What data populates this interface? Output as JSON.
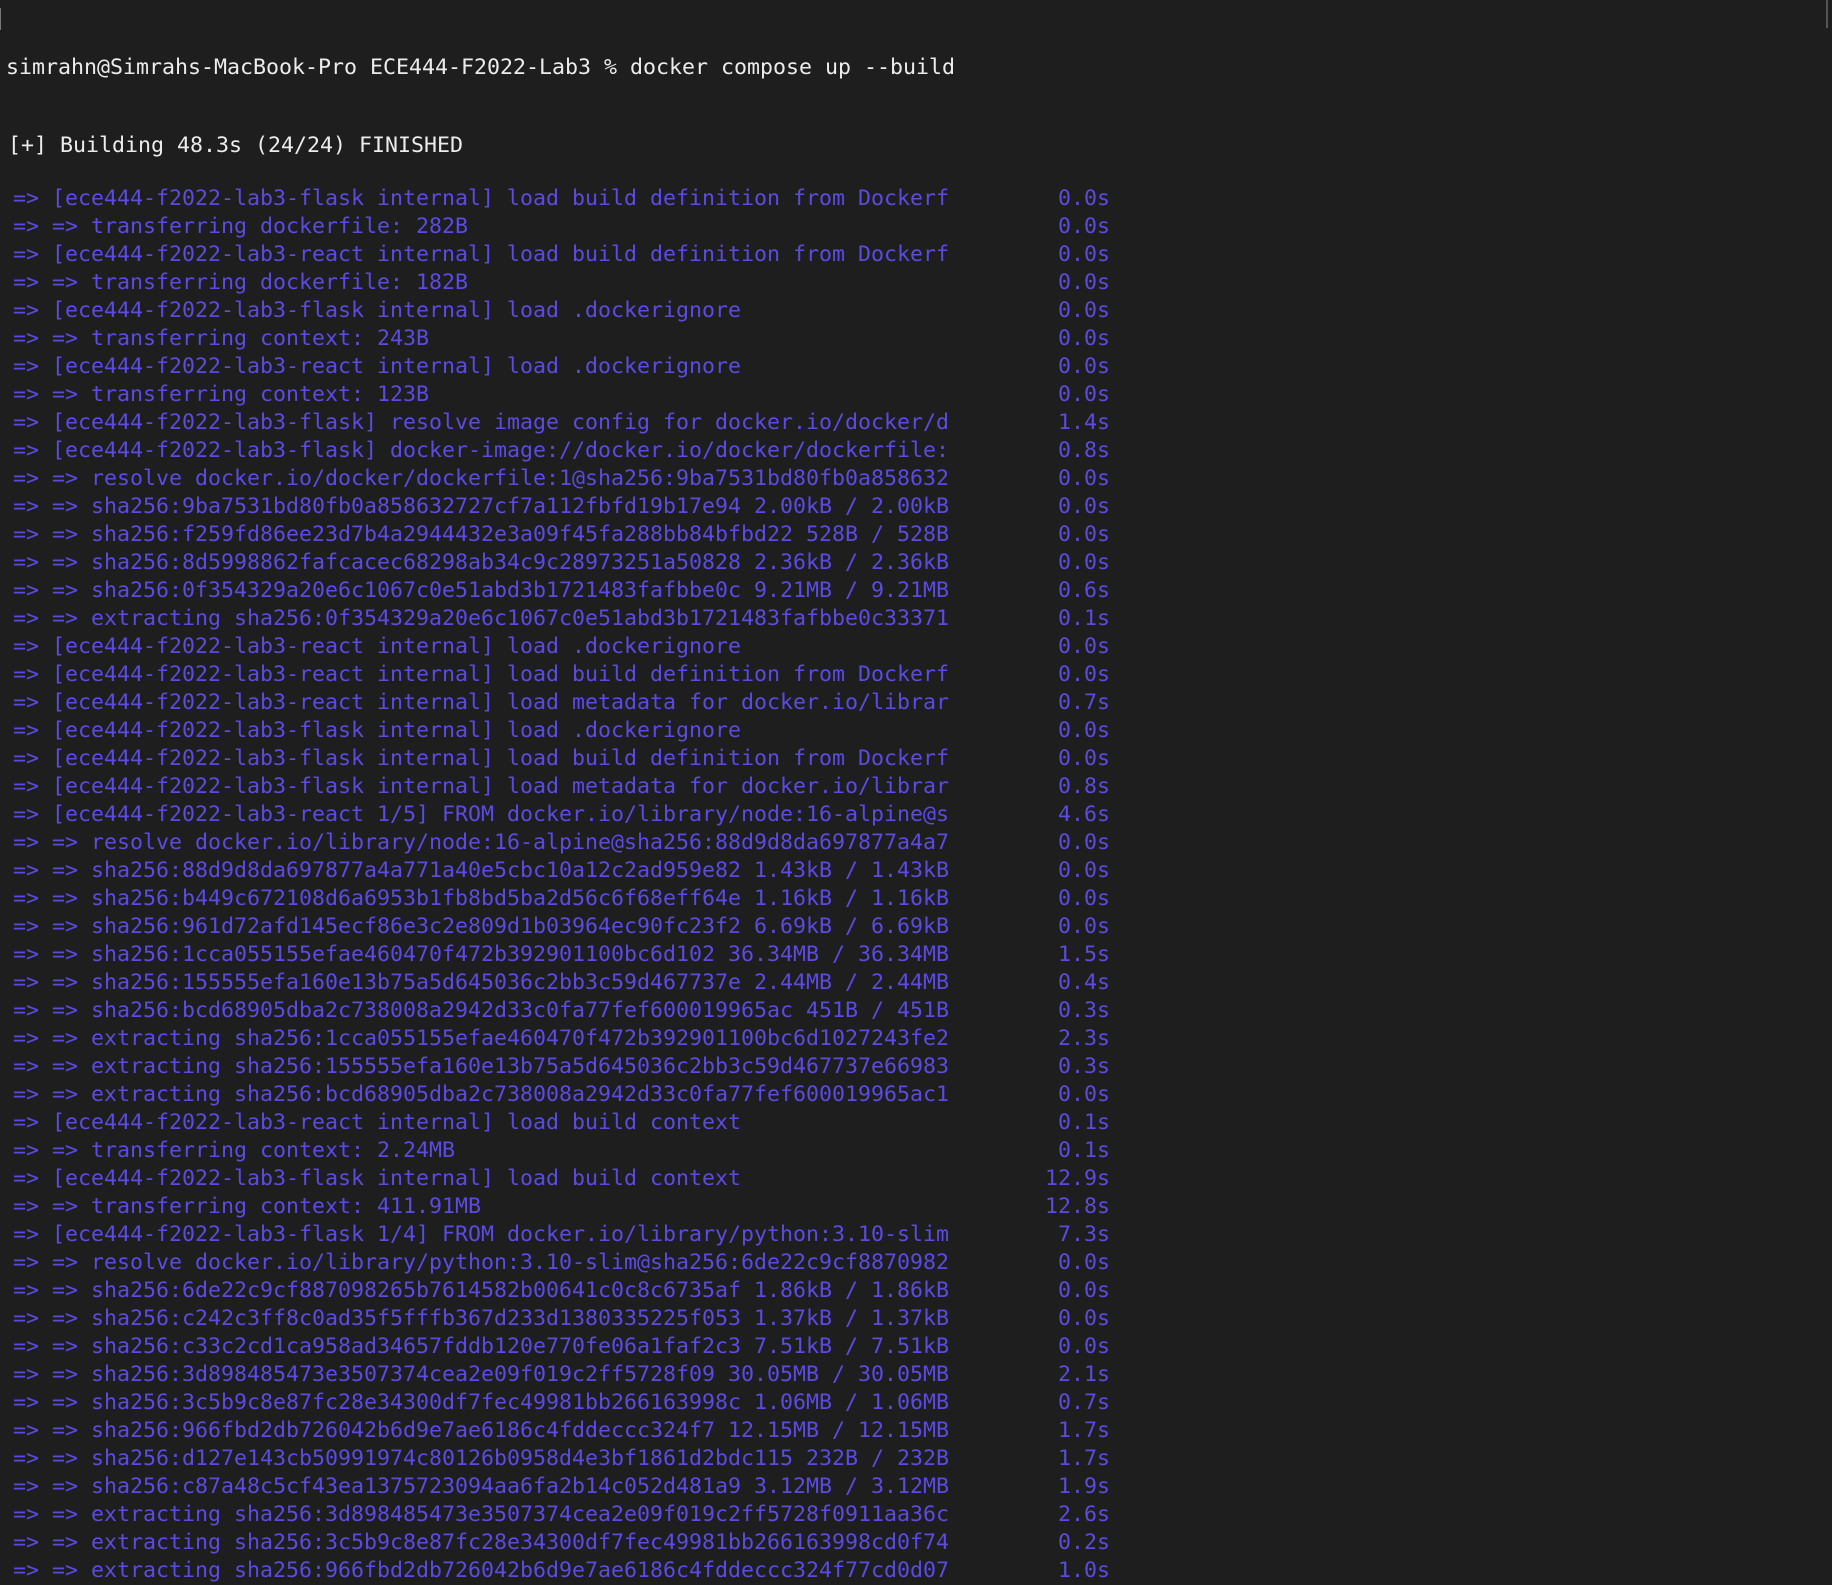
{
  "terminal": {
    "prompt": "simrahn@Simrahs-MacBook-Pro ECE444-F2022-Lab3 % docker compose up --build",
    "status": "[+] Building 48.3s (24/24) FINISHED",
    "text_color": "#ececec",
    "log_color": "#5b4be3",
    "background": "#1e1e1e",
    "lines": [
      {
        "text": " => [ece444-f2022-lab3-flask internal] load build definition from Dockerf",
        "time": "0.0s"
      },
      {
        "text": " => => transferring dockerfile: 282B",
        "time": "0.0s"
      },
      {
        "text": " => [ece444-f2022-lab3-react internal] load build definition from Dockerf",
        "time": "0.0s"
      },
      {
        "text": " => => transferring dockerfile: 182B",
        "time": "0.0s"
      },
      {
        "text": " => [ece444-f2022-lab3-flask internal] load .dockerignore",
        "time": "0.0s"
      },
      {
        "text": " => => transferring context: 243B",
        "time": "0.0s"
      },
      {
        "text": " => [ece444-f2022-lab3-react internal] load .dockerignore",
        "time": "0.0s"
      },
      {
        "text": " => => transferring context: 123B",
        "time": "0.0s"
      },
      {
        "text": " => [ece444-f2022-lab3-flask] resolve image config for docker.io/docker/d",
        "time": "1.4s"
      },
      {
        "text": " => [ece444-f2022-lab3-flask] docker-image://docker.io/docker/dockerfile:",
        "time": "0.8s"
      },
      {
        "text": " => => resolve docker.io/docker/dockerfile:1@sha256:9ba7531bd80fb0a858632",
        "time": "0.0s"
      },
      {
        "text": " => => sha256:9ba7531bd80fb0a858632727cf7a112fbfd19b17e94 2.00kB / 2.00kB",
        "time": "0.0s"
      },
      {
        "text": " => => sha256:f259fd86ee23d7b4a2944432e3a09f45fa288bb84bfbd22 528B / 528B",
        "time": "0.0s"
      },
      {
        "text": " => => sha256:8d5998862fafcacec68298ab34c9c28973251a50828 2.36kB / 2.36kB",
        "time": "0.0s"
      },
      {
        "text": " => => sha256:0f354329a20e6c1067c0e51abd3b1721483fafbbe0c 9.21MB / 9.21MB",
        "time": "0.6s"
      },
      {
        "text": " => => extracting sha256:0f354329a20e6c1067c0e51abd3b1721483fafbbe0c33371",
        "time": "0.1s"
      },
      {
        "text": " => [ece444-f2022-lab3-react internal] load .dockerignore",
        "time": "0.0s"
      },
      {
        "text": " => [ece444-f2022-lab3-react internal] load build definition from Dockerf",
        "time": "0.0s"
      },
      {
        "text": " => [ece444-f2022-lab3-react internal] load metadata for docker.io/librar",
        "time": "0.7s"
      },
      {
        "text": " => [ece444-f2022-lab3-flask internal] load .dockerignore",
        "time": "0.0s"
      },
      {
        "text": " => [ece444-f2022-lab3-flask internal] load build definition from Dockerf",
        "time": "0.0s"
      },
      {
        "text": " => [ece444-f2022-lab3-flask internal] load metadata for docker.io/librar",
        "time": "0.8s"
      },
      {
        "text": " => [ece444-f2022-lab3-react 1/5] FROM docker.io/library/node:16-alpine@s",
        "time": "4.6s"
      },
      {
        "text": " => => resolve docker.io/library/node:16-alpine@sha256:88d9d8da697877a4a7",
        "time": "0.0s"
      },
      {
        "text": " => => sha256:88d9d8da697877a4a771a40e5cbc10a12c2ad959e82 1.43kB / 1.43kB",
        "time": "0.0s"
      },
      {
        "text": " => => sha256:b449c672108d6a6953b1fb8bd5ba2d56c6f68eff64e 1.16kB / 1.16kB",
        "time": "0.0s"
      },
      {
        "text": " => => sha256:961d72afd145ecf86e3c2e809d1b03964ec90fc23f2 6.69kB / 6.69kB",
        "time": "0.0s"
      },
      {
        "text": " => => sha256:1cca055155efae460470f472b392901100bc6d102 36.34MB / 36.34MB",
        "time": "1.5s"
      },
      {
        "text": " => => sha256:155555efa160e13b75a5d645036c2bb3c59d467737e 2.44MB / 2.44MB",
        "time": "0.4s"
      },
      {
        "text": " => => sha256:bcd68905dba2c738008a2942d33c0fa77fef600019965ac 451B / 451B",
        "time": "0.3s"
      },
      {
        "text": " => => extracting sha256:1cca055155efae460470f472b392901100bc6d1027243fe2",
        "time": "2.3s"
      },
      {
        "text": " => => extracting sha256:155555efa160e13b75a5d645036c2bb3c59d467737e66983",
        "time": "0.3s"
      },
      {
        "text": " => => extracting sha256:bcd68905dba2c738008a2942d33c0fa77fef600019965ac1",
        "time": "0.0s"
      },
      {
        "text": " => [ece444-f2022-lab3-react internal] load build context",
        "time": "0.1s"
      },
      {
        "text": " => => transferring context: 2.24MB",
        "time": "0.1s"
      },
      {
        "text": " => [ece444-f2022-lab3-flask internal] load build context",
        "time": "12.9s"
      },
      {
        "text": " => => transferring context: 411.91MB",
        "time": "12.8s"
      },
      {
        "text": " => [ece444-f2022-lab3-flask 1/4] FROM docker.io/library/python:3.10-slim",
        "time": "7.3s"
      },
      {
        "text": " => => resolve docker.io/library/python:3.10-slim@sha256:6de22c9cf8870982",
        "time": "0.0s"
      },
      {
        "text": " => => sha256:6de22c9cf887098265b7614582b00641c0c8c6735af 1.86kB / 1.86kB",
        "time": "0.0s"
      },
      {
        "text": " => => sha256:c242c3ff8c0ad35f5fffb367d233d1380335225f053 1.37kB / 1.37kB",
        "time": "0.0s"
      },
      {
        "text": " => => sha256:c33c2cd1ca958ad34657fddb120e770fe06a1faf2c3 7.51kB / 7.51kB",
        "time": "0.0s"
      },
      {
        "text": " => => sha256:3d898485473e3507374cea2e09f019c2ff5728f09 30.05MB / 30.05MB",
        "time": "2.1s"
      },
      {
        "text": " => => sha256:3c5b9c8e87fc28e34300df7fec49981bb266163998c 1.06MB / 1.06MB",
        "time": "0.7s"
      },
      {
        "text": " => => sha256:966fbd2db726042b6d9e7ae6186c4fddeccc324f7 12.15MB / 12.15MB",
        "time": "1.7s"
      },
      {
        "text": " => => sha256:d127e143cb50991974c80126b0958d4e3bf1861d2bdc115 232B / 232B",
        "time": "1.7s"
      },
      {
        "text": " => => sha256:c87a48c5cf43ea1375723094aa6fa2b14c052d481a9 3.12MB / 3.12MB",
        "time": "1.9s"
      },
      {
        "text": " => => extracting sha256:3d898485473e3507374cea2e09f019c2ff5728f0911aa36c",
        "time": "2.6s"
      },
      {
        "text": " => => extracting sha256:3c5b9c8e87fc28e34300df7fec49981bb266163998cd0f74",
        "time": "0.2s"
      },
      {
        "text": " => => extracting sha256:966fbd2db726042b6d9e7ae6186c4fddeccc324f77cd0d07",
        "time": "1.0s"
      }
    ]
  }
}
